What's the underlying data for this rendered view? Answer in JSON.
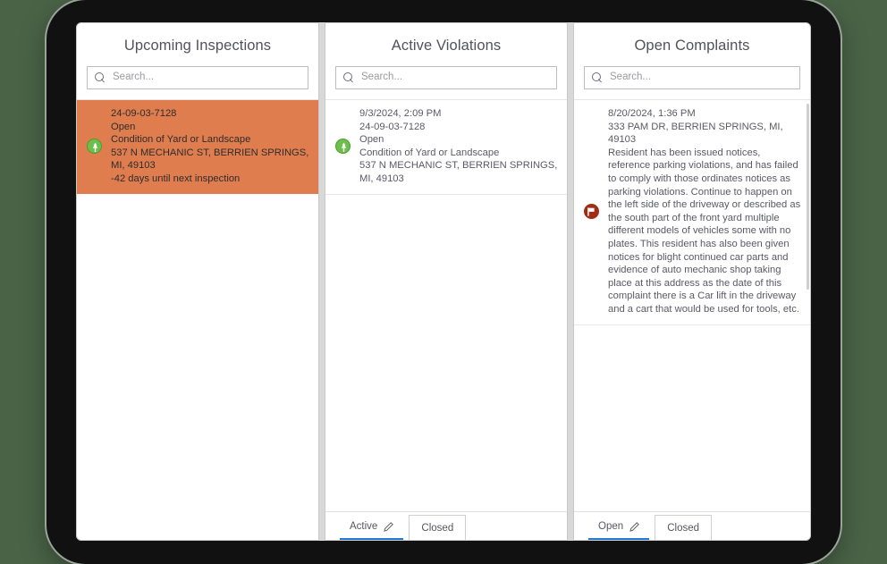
{
  "device": {
    "frame_color": "#111111",
    "background_color": "#4a6347"
  },
  "accent": {
    "selected_row": "#df7d4f",
    "active_tab_underline": "#1f7ad6",
    "green_marker": "#6dbe4b",
    "flag_marker": "#a02c16"
  },
  "panels": [
    {
      "id": "upcoming-inspections",
      "title": "Upcoming Inspections",
      "search": {
        "placeholder": "Search..."
      },
      "items": [
        {
          "icon": "green-tree-marker-icon",
          "selected": true,
          "lines": [
            "24-09-03-7128",
            "Open",
            "Condition of Yard or Landscape",
            "537 N MECHANIC ST, BERRIEN SPRINGS, MI, 49103",
            "-42 days until next inspection"
          ]
        }
      ],
      "tabs": []
    },
    {
      "id": "active-violations",
      "title": "Active Violations",
      "search": {
        "placeholder": "Search..."
      },
      "items": [
        {
          "icon": "green-tree-marker-icon",
          "selected": false,
          "lines": [
            "9/3/2024, 2:09 PM",
            "24-09-03-7128",
            "Open",
            "Condition of Yard or Landscape",
            "537 N MECHANIC ST, BERRIEN SPRINGS, MI, 49103"
          ]
        }
      ],
      "tabs": [
        {
          "label": "Active",
          "active": true,
          "has_edit_icon": true
        },
        {
          "label": "Closed",
          "active": false,
          "has_edit_icon": false
        }
      ]
    },
    {
      "id": "open-complaints",
      "title": "Open Complaints",
      "search": {
        "placeholder": "Search..."
      },
      "items": [
        {
          "icon": "red-flag-marker-icon",
          "selected": false,
          "lines": [
            "8/20/2024, 1:36 PM",
            "333 PAM DR, BERRIEN SPRINGS, MI, 49103",
            "Resident has been issued notices, reference parking violations, and has failed to comply with those ordinates notices as parking violations. Continue to happen on the left side of the driveway or described as the south part of the front yard multiple different models of vehicles some with no plates. This resident has also been given notices for blight continued car parts and evidence of auto mechanic shop taking place at this address as the date of this complaint there is a Car lift in the driveway and a cart that would be used for tools, etc."
          ]
        }
      ],
      "tabs": [
        {
          "label": "Open",
          "active": true,
          "has_edit_icon": true
        },
        {
          "label": "Closed",
          "active": false,
          "has_edit_icon": false
        }
      ]
    }
  ]
}
